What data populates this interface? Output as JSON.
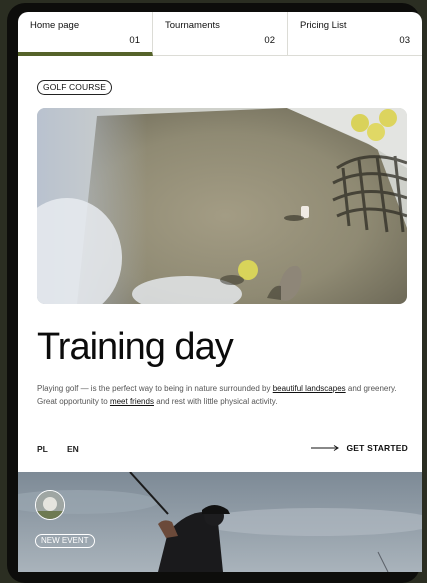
{
  "nav": {
    "items": [
      {
        "label": "Home page",
        "num": "01"
      },
      {
        "label": "Tournaments",
        "num": "02"
      },
      {
        "label": "Pricing List",
        "num": "03"
      }
    ],
    "active_color": "#55632a"
  },
  "hero": {
    "tag": "GOLF COURSE",
    "title": "Training day",
    "desc_part1": "Playing golf — is the perfect way to being in nature surrounded by ",
    "link1": "beautiful landscapes",
    "desc_part2": " and greenery. Great opportunity to ",
    "link2": "meet friends",
    "desc_part3": " and rest with little physical activity."
  },
  "lang": {
    "pl": "PL",
    "en": "EN"
  },
  "cta": {
    "label": "GET STARTED",
    "icon": "arrow-right-icon"
  },
  "event": {
    "label": "NEW EVENT"
  }
}
